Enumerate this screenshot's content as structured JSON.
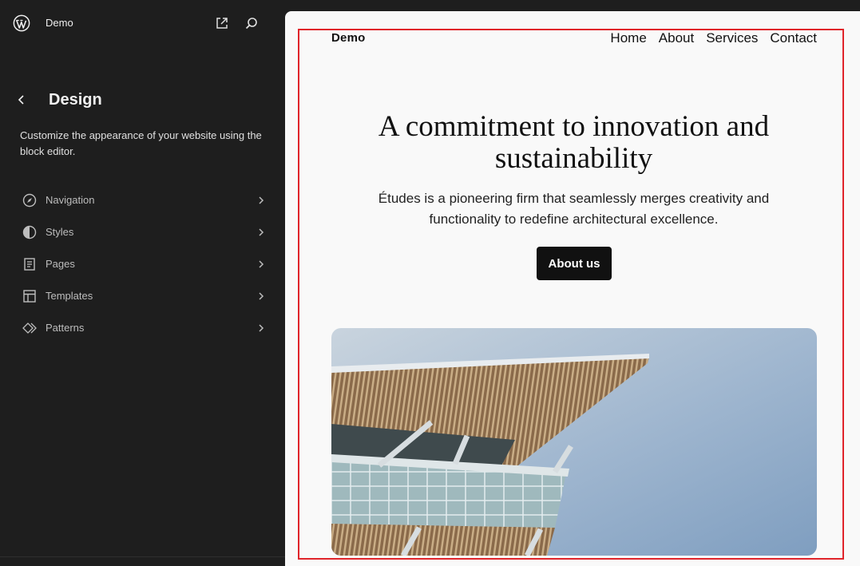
{
  "sidebar": {
    "site_name": "Demo",
    "panel_title": "Design",
    "panel_description": "Customize the appearance of your website using the block editor.",
    "items": [
      {
        "label": "Navigation",
        "icon": "navigation-compass-icon"
      },
      {
        "label": "Styles",
        "icon": "styles-half-circle-icon"
      },
      {
        "label": "Pages",
        "icon": "pages-document-icon"
      },
      {
        "label": "Templates",
        "icon": "templates-layout-icon"
      },
      {
        "label": "Patterns",
        "icon": "patterns-diamond-icon"
      }
    ]
  },
  "preview": {
    "brand": "Demo",
    "nav": [
      "Home",
      "About",
      "Services",
      "Contact"
    ],
    "hero_title": "A commitment to innovation and sustainability",
    "hero_subtitle": "Études is a pioneering firm that seamlessly merges creativity and functionality to redefine architectural excellence.",
    "cta_label": "About us"
  },
  "colors": {
    "sidebar_bg": "#1e1e1e",
    "preview_bg": "#f9f9f9",
    "focus_outline": "#e0242a",
    "button_bg": "#111111"
  }
}
